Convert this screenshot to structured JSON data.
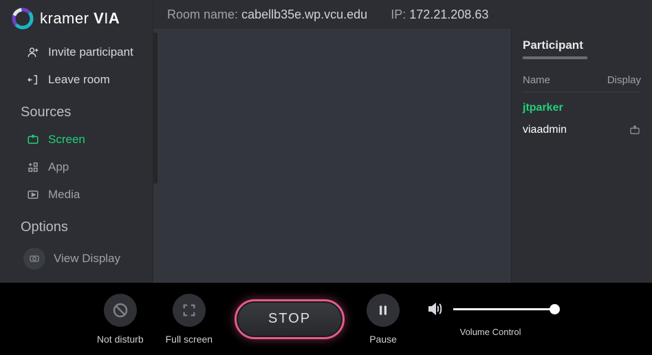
{
  "brand": {
    "name1": "kramer",
    "name2": "V",
    "name3": "I",
    "name4": "A"
  },
  "sidebar": {
    "invite": "Invite participant",
    "leave": "Leave room",
    "sources_heading": "Sources",
    "screen": "Screen",
    "app": "App",
    "media": "Media",
    "options_heading": "Options",
    "view_display": "View Display"
  },
  "header": {
    "room_label": "Room name:",
    "room_value": "cabellb35e.wp.vcu.edu",
    "ip_label": "IP:",
    "ip_value": "172.21.208.63"
  },
  "panel": {
    "title": "Participant",
    "col_name": "Name",
    "col_display": "Display",
    "rows": [
      {
        "name": "jtparker",
        "me": true
      },
      {
        "name": "viaadmin",
        "me": false
      }
    ]
  },
  "controls": {
    "dnd": "Not disturb",
    "fullscreen": "Full screen",
    "stop": "STOP",
    "pause": "Pause",
    "volume": "Volume Control"
  }
}
